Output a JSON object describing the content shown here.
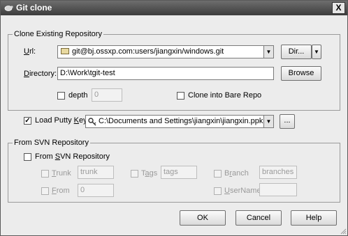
{
  "window": {
    "title": "Git clone",
    "close_glyph": "X"
  },
  "clone_group": {
    "title": "Clone Existing Repository",
    "url_label": "Url:",
    "url_value": "git@bj.ossxp.com:users/jiangxin/windows.git",
    "dir_button": "Dir...",
    "directory_label": "Directory:",
    "directory_value": "D:\\Work\\tgit-test",
    "browse_button": "Browse",
    "depth_label": "depth",
    "depth_value": "0",
    "bare_label": "Clone into Bare Repo"
  },
  "putty": {
    "label": "Load Putty Key",
    "checked": true,
    "value": "C:\\Documents and Settings\\jiangxin\\jiangxin.ppk",
    "browse_button": "..."
  },
  "svn_group": {
    "title": "From SVN Repository",
    "checkbox_label": "From SVN Repository",
    "trunk_label": "Trunk",
    "trunk_value": "trunk",
    "tags_label": "Tags",
    "tags_value": "tags",
    "branch_label": "Branch",
    "branch_value": "branches",
    "from_label": "From",
    "from_value": "0",
    "username_label": "UserName",
    "username_value": ""
  },
  "buttons": {
    "ok": "OK",
    "cancel": "Cancel",
    "help": "Help"
  },
  "icons": {
    "title": "tortoise-icon",
    "url_folder": "folder-icon",
    "putty_key": "key-icon"
  }
}
